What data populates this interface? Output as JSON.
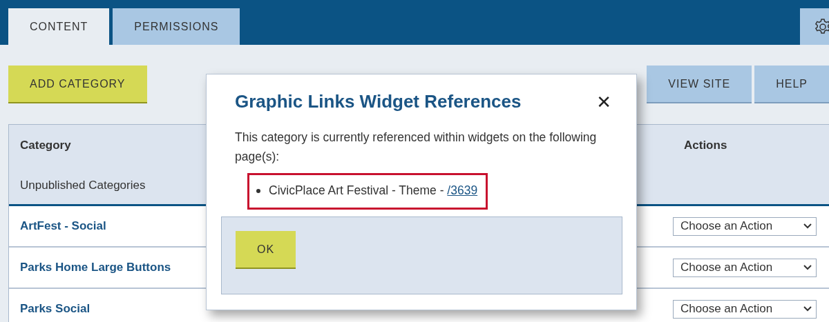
{
  "tabs": [
    {
      "label": "CONTENT",
      "selected": true
    },
    {
      "label": "PERMISSIONS",
      "selected": false
    }
  ],
  "toolbar": {
    "add_button": "ADD CATEGORY",
    "right_buttons": [
      "VIEW SITE",
      "HELP"
    ]
  },
  "table": {
    "columns": [
      "Category",
      "Actions"
    ],
    "group_label": "Unpublished Categories",
    "rows": [
      {
        "name": "ArtFest - Social",
        "action": "Choose an Action"
      },
      {
        "name": "Parks Home Large Buttons",
        "action": "Choose an Action"
      },
      {
        "name": "Parks Social",
        "action": "Choose an Action"
      }
    ]
  },
  "dialog": {
    "title": "Graphic Links Widget References",
    "close": "✕",
    "message": "This category is currently referenced within widgets on the following page(s):",
    "references": [
      {
        "text": "CivicPlace Art Festival - Theme - ",
        "link": "/3639",
        "highlighted": true
      }
    ],
    "ok_button": "OK"
  }
}
